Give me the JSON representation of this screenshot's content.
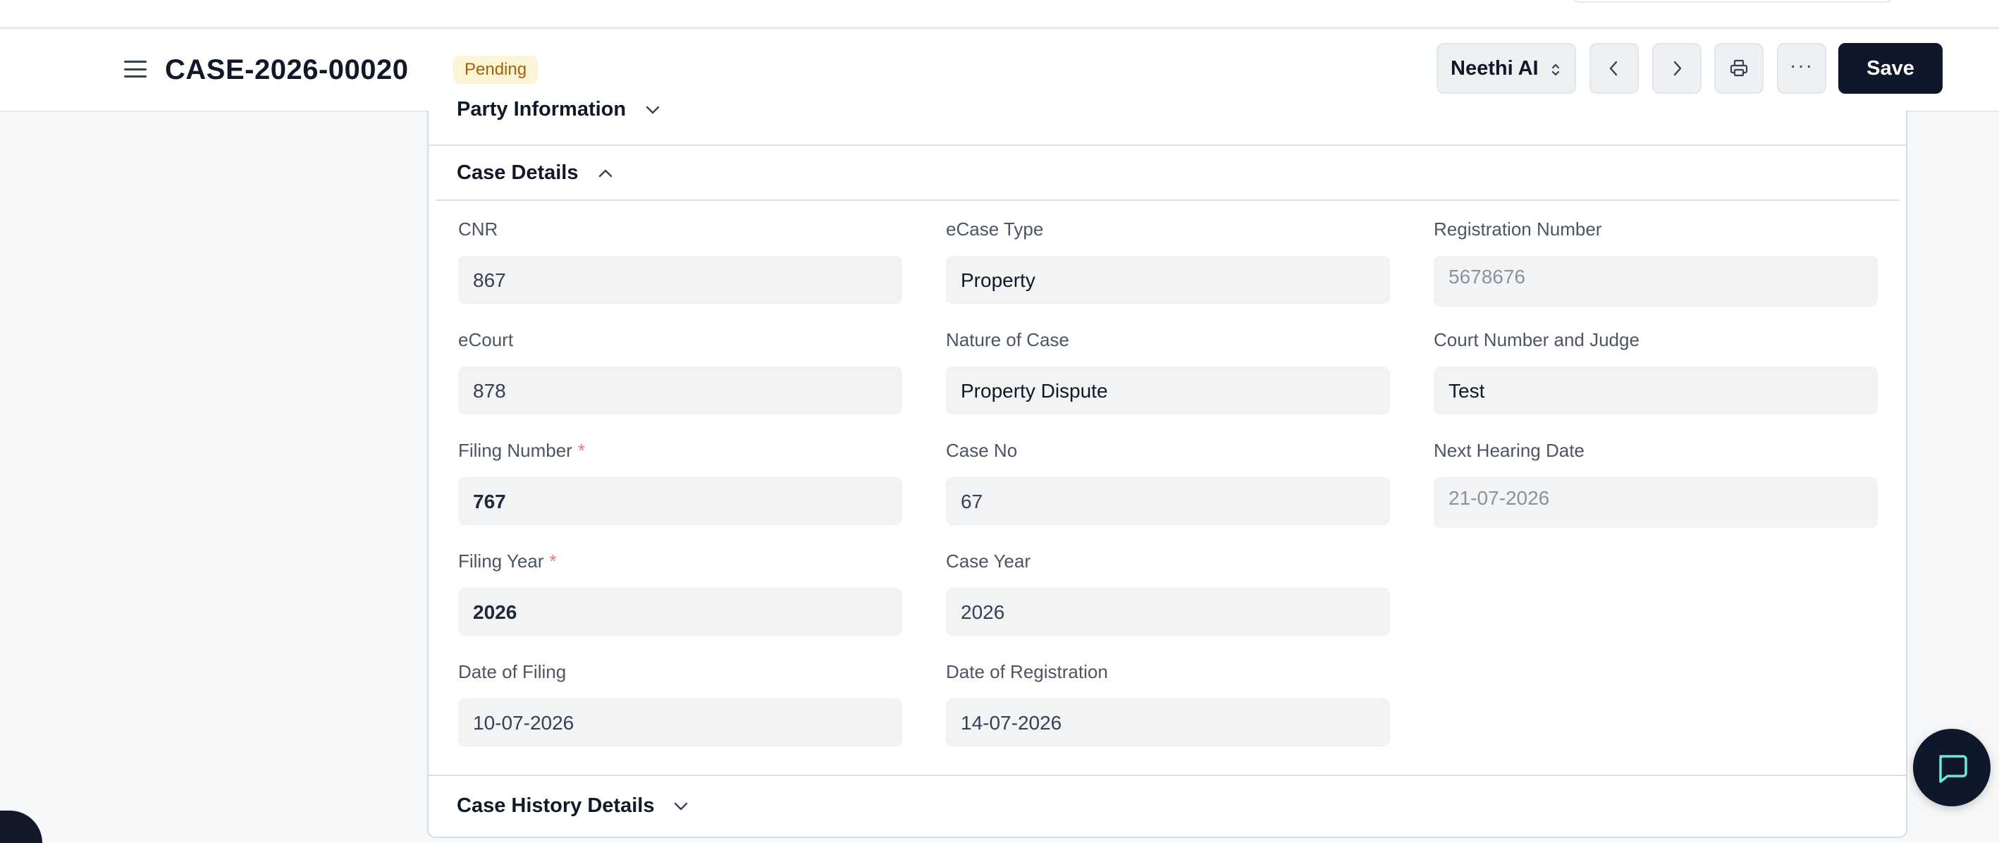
{
  "header": {
    "doc_id": "CASE-2026-00020",
    "status": "Pending",
    "select_value": "Neethi AI",
    "save_label": "Save",
    "more_label": "···"
  },
  "sections": {
    "party": "Party Information",
    "case_details": "Case Details",
    "history": "Case History Details"
  },
  "fields": {
    "cnr": {
      "label": "CNR",
      "value": "867"
    },
    "ecase_type": {
      "label": "eCase Type",
      "value": "Property"
    },
    "registration_number": {
      "label": "Registration Number",
      "value": "5678676"
    },
    "ecourt": {
      "label": "eCourt",
      "value": "878"
    },
    "nature_of_case": {
      "label": "Nature of Case",
      "value": "Property Dispute"
    },
    "court_number_judge": {
      "label": "Court Number and Judge",
      "value": "Test"
    },
    "filing_number": {
      "label": "Filing Number",
      "required": "*",
      "value": "767"
    },
    "case_no": {
      "label": "Case No",
      "value": "67"
    },
    "next_hearing_date": {
      "label": "Next Hearing Date",
      "value": "21-07-2026"
    },
    "filing_year": {
      "label": "Filing Year",
      "required": "*",
      "value": "2026"
    },
    "case_year": {
      "label": "Case Year",
      "value": "2026"
    },
    "date_of_filing": {
      "label": "Date of Filing",
      "value": "10-07-2026"
    },
    "date_of_registration": {
      "label": "Date of Registration",
      "value": "14-07-2026"
    }
  },
  "icons": {
    "menu": "hamburger-icon",
    "select_arrows": "chevron-up-down-icon",
    "prev": "chevron-left-icon",
    "next": "chevron-right-icon",
    "print": "printer-icon",
    "section_toggle": "chevron-icon",
    "chat": "chat-icon"
  },
  "colors": {
    "primary": "#0f172a",
    "badge_bg": "#fdf3d5",
    "badge_text": "#a16207",
    "required": "#f87171"
  }
}
